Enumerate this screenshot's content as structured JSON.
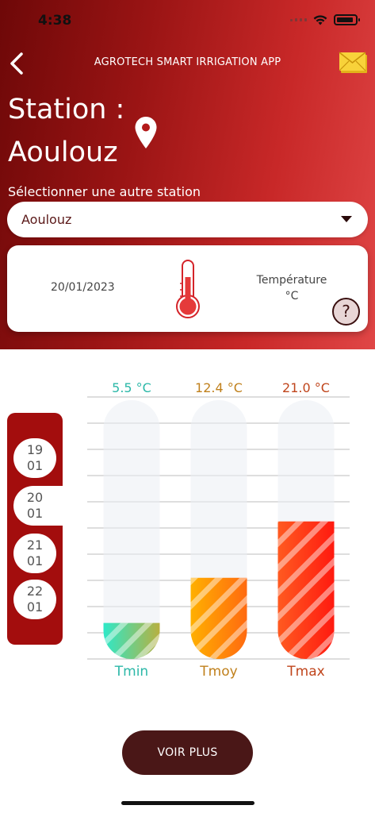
{
  "status": {
    "time": "4:38"
  },
  "header": {
    "app_title": "AGROTECH SMART IRRIGATION APP",
    "station_label": "Station :",
    "station_name": "Aoulouz",
    "select_label": "Sélectionner une autre station"
  },
  "dropdown": {
    "value": "Aoulouz"
  },
  "info_card": {
    "date": "20/01/2023",
    "label_line1": "Température",
    "label_line2": "°C",
    "help": "?"
  },
  "date_tabs": [
    {
      "day": "19",
      "month": "01",
      "active": false
    },
    {
      "day": "20",
      "month": "01",
      "active": true
    },
    {
      "day": "21",
      "month": "01",
      "active": false
    },
    {
      "day": "22",
      "month": "01",
      "active": false
    }
  ],
  "chart_data": {
    "type": "bar",
    "categories": [
      "Tmin",
      "Tmoy",
      "Tmax"
    ],
    "values": [
      5.5,
      12.4,
      21.0
    ],
    "value_labels": [
      "5.5 °C",
      "12.4 °C",
      "21.0 °C"
    ],
    "ylim": [
      0,
      40
    ],
    "grid": true,
    "colors": {
      "Tmin": [
        "#2ee8c8",
        "#b8b040"
      ],
      "Tmoy": [
        "#ffb000",
        "#ff6a10"
      ],
      "Tmax": [
        "#ff5a20",
        "#ff1a10"
      ]
    },
    "label_colors": {
      "Tmin": "#2cb8a8",
      "Tmoy": "#c0801c",
      "Tmax": "#c0451c"
    }
  },
  "actions": {
    "voir_plus": "VOIR PLUS"
  },
  "colors": {
    "accent": "#a30d0d",
    "button": "#4a1717"
  }
}
